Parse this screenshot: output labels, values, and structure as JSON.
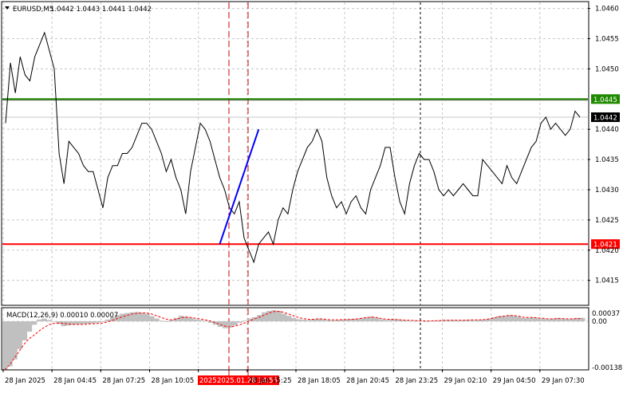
{
  "header": {
    "symbol": "EURUSD,M5",
    "ohlc": "1.0442 1.0443 1.0441 1.0442"
  },
  "chart_data": [
    {
      "type": "line",
      "name": "price-panel",
      "ylim": [
        1.0411,
        1.0461
      ],
      "y_ticks": [
        "1.0460",
        "1.0455",
        "1.0450",
        "1.0440",
        "1.0435",
        "1.0430",
        "1.0425",
        "1.0420",
        "1.0415"
      ],
      "h_levels": [
        {
          "value": 1.0445,
          "label": "1.0445",
          "color": "#1f8a00"
        },
        {
          "value": 1.0442,
          "label": "1.0442",
          "color": "#000000"
        },
        {
          "value": 1.0421,
          "label": "1.0421",
          "color": "#ff0000"
        }
      ],
      "series_close": [
        1.0441,
        1.0451,
        1.0446,
        1.0452,
        1.0449,
        1.0448,
        1.0452,
        1.0454,
        1.0456,
        1.0453,
        1.045,
        1.0436,
        1.0431,
        1.0438,
        1.0437,
        1.0436,
        1.0434,
        1.0433,
        1.0433,
        1.043,
        1.0427,
        1.0432,
        1.0434,
        1.0434,
        1.0436,
        1.0436,
        1.0437,
        1.0439,
        1.0441,
        1.0441,
        1.044,
        1.0438,
        1.0436,
        1.0433,
        1.0435,
        1.0432,
        1.043,
        1.0426,
        1.0433,
        1.0437,
        1.0441,
        1.044,
        1.0438,
        1.0435,
        1.0432,
        1.043,
        1.0427,
        1.0426,
        1.0428,
        1.0422,
        1.042,
        1.0418,
        1.0421,
        1.0422,
        1.0423,
        1.0421,
        1.0425,
        1.0427,
        1.0426,
        1.043,
        1.0433,
        1.0435,
        1.0437,
        1.0438,
        1.044,
        1.0438,
        1.0432,
        1.0429,
        1.0427,
        1.0428,
        1.0426,
        1.0428,
        1.0429,
        1.0427,
        1.0426,
        1.043,
        1.0432,
        1.0434,
        1.0437,
        1.0437,
        1.0432,
        1.0428,
        1.0426,
        1.0431,
        1.0434,
        1.0436,
        1.0435,
        1.0435,
        1.0433,
        1.043,
        1.0429,
        1.043,
        1.0429,
        1.043,
        1.0431,
        1.043,
        1.0429,
        1.0429,
        1.0435,
        1.0434,
        1.0433,
        1.0432,
        1.0431,
        1.0434,
        1.0432,
        1.0431,
        1.0433,
        1.0435,
        1.0437,
        1.0438,
        1.0441,
        1.0442,
        1.044,
        1.0441,
        1.044,
        1.0439,
        1.044,
        1.0443,
        1.0442
      ],
      "trend_line": [
        [
          44,
          1.0421
        ],
        [
          52,
          1.044
        ]
      ],
      "x_axis_labels": [
        "28 Jan 2025",
        "28 Jan 04:45",
        "28 Jan 07:25",
        "28 Jan 10:05",
        "2025.01.28 14:55",
        "28 Jan 15:25",
        "28 Jan 18:05",
        "28 Jan 20:45",
        "28 Jan 23:25",
        "29 Jan 02:10",
        "29 Jan 04:50",
        "29 Jan 07:30"
      ],
      "x_axis_highlight": "2025"
    },
    {
      "type": "bar",
      "name": "macd-panel",
      "title": "MACD(12,26,9) 0.00010 0.00007",
      "ylim": [
        -0.00138,
        0.00037
      ],
      "y_ticks": [
        "0.00037",
        "0.00",
        "-0.00138"
      ],
      "histogram": [
        -0.00138,
        -0.0013,
        -0.0011,
        -0.0008,
        -0.00055,
        -0.0003,
        -0.0001,
        5e-05,
        8e-05,
        4e-05,
        0.0,
        -8e-05,
        -0.00014,
        -0.00012,
        -0.0001,
        -9e-05,
        -8e-05,
        -7e-05,
        -6e-05,
        -4e-05,
        -2e-05,
        5e-05,
        0.00012,
        0.00018,
        0.00022,
        0.00024,
        0.00026,
        0.00027,
        0.00025,
        0.00022,
        0.00015,
        8e-05,
        2e-05,
        -2e-05,
        4e-05,
        0.0001,
        0.00016,
        0.00014,
        0.0001,
        6e-05,
        4e-05,
        2e-05,
        -4e-05,
        -0.0001,
        -0.00016,
        -0.0002,
        -0.00018,
        -0.00012,
        -4e-05,
        2e-05,
        8e-05,
        0.00012,
        0.00018,
        0.00026,
        0.0003,
        0.00032,
        0.0003,
        0.00022,
        0.00016,
        0.0001,
        6e-05,
        5e-05,
        4e-05,
        6e-05,
        8e-05,
        6e-05,
        4e-05,
        3e-05,
        4e-05,
        5e-05,
        6e-05,
        7e-05,
        8e-05,
        0.0001,
        0.00012,
        0.00014,
        0.0001,
        6e-05,
        4e-05,
        6e-05,
        6e-05,
        4e-05,
        3e-05,
        2e-05,
        2e-05,
        1e-05,
        0.0,
        1e-05,
        2e-05,
        3e-05,
        4e-05,
        4e-05,
        4e-05,
        3e-05,
        4e-05,
        4e-05,
        3e-05,
        4e-05,
        6e-05,
        8e-05,
        0.00012,
        0.00015,
        0.00016,
        0.00018,
        0.00017,
        0.00014,
        0.0001,
        0.0001,
        0.00012,
        0.0001,
        8e-05,
        6e-05,
        8e-05,
        0.0001,
        8e-05,
        6e-05,
        8e-05,
        0.0001,
        0.0001
      ],
      "signal": [
        -0.0014,
        -0.00125,
        -0.00105,
        -0.00085,
        -0.00065,
        -0.0005,
        -0.0004,
        -0.00028,
        -0.00018,
        -0.0001,
        -6e-05,
        -5e-05,
        -6e-05,
        -8e-05,
        -9e-05,
        -9e-05,
        -9e-05,
        -8e-05,
        -7e-05,
        -6e-05,
        -5e-05,
        -2e-05,
        3e-05,
        8e-05,
        0.00013,
        0.00017,
        0.00021,
        0.00023,
        0.00024,
        0.00024,
        0.00021,
        0.00016,
        0.00011,
        6e-05,
        4e-05,
        6e-05,
        0.0001,
        0.00012,
        0.00011,
        9e-05,
        7e-05,
        4e-05,
        1e-05,
        -4e-05,
        -9e-05,
        -0.00014,
        -0.00016,
        -0.00014,
        -0.0001,
        -5e-05,
        1e-05,
        7e-05,
        0.00012,
        0.00018,
        0.00024,
        0.00028,
        0.00029,
        0.00026,
        0.00021,
        0.00016,
        0.00011,
        8e-05,
        6e-05,
        6e-05,
        7e-05,
        7e-05,
        5e-05,
        4e-05,
        4e-05,
        5e-05,
        5e-05,
        6e-05,
        7e-05,
        9e-05,
        0.00011,
        0.00012,
        0.00011,
        8e-05,
        6e-05,
        6e-05,
        5e-05,
        4e-05,
        3e-05,
        3e-05,
        2e-05,
        2e-05,
        1e-05,
        1e-05,
        2e-05,
        2e-05,
        3e-05,
        3e-05,
        3e-05,
        3e-05,
        3e-05,
        4e-05,
        4e-05,
        4e-05,
        5e-05,
        7e-05,
        0.0001,
        0.00013,
        0.00015,
        0.00017,
        0.00017,
        0.00015,
        0.00012,
        0.00011,
        0.00011,
        0.0001,
        9e-05,
        7e-05,
        7e-05,
        8e-05,
        8e-05,
        7e-05,
        7e-05,
        8e-05,
        8e-05
      ]
    }
  ],
  "colors": {
    "grid": "#c8c8c8",
    "price_line": "#000000",
    "trend_line": "#0000ff",
    "vline": "#cc0000",
    "vline_black": "#000000",
    "macd_hist": "#c0c0c0",
    "macd_signal": "#ff0000",
    "level_green": "#1f8a00",
    "level_red": "#ff0000"
  }
}
